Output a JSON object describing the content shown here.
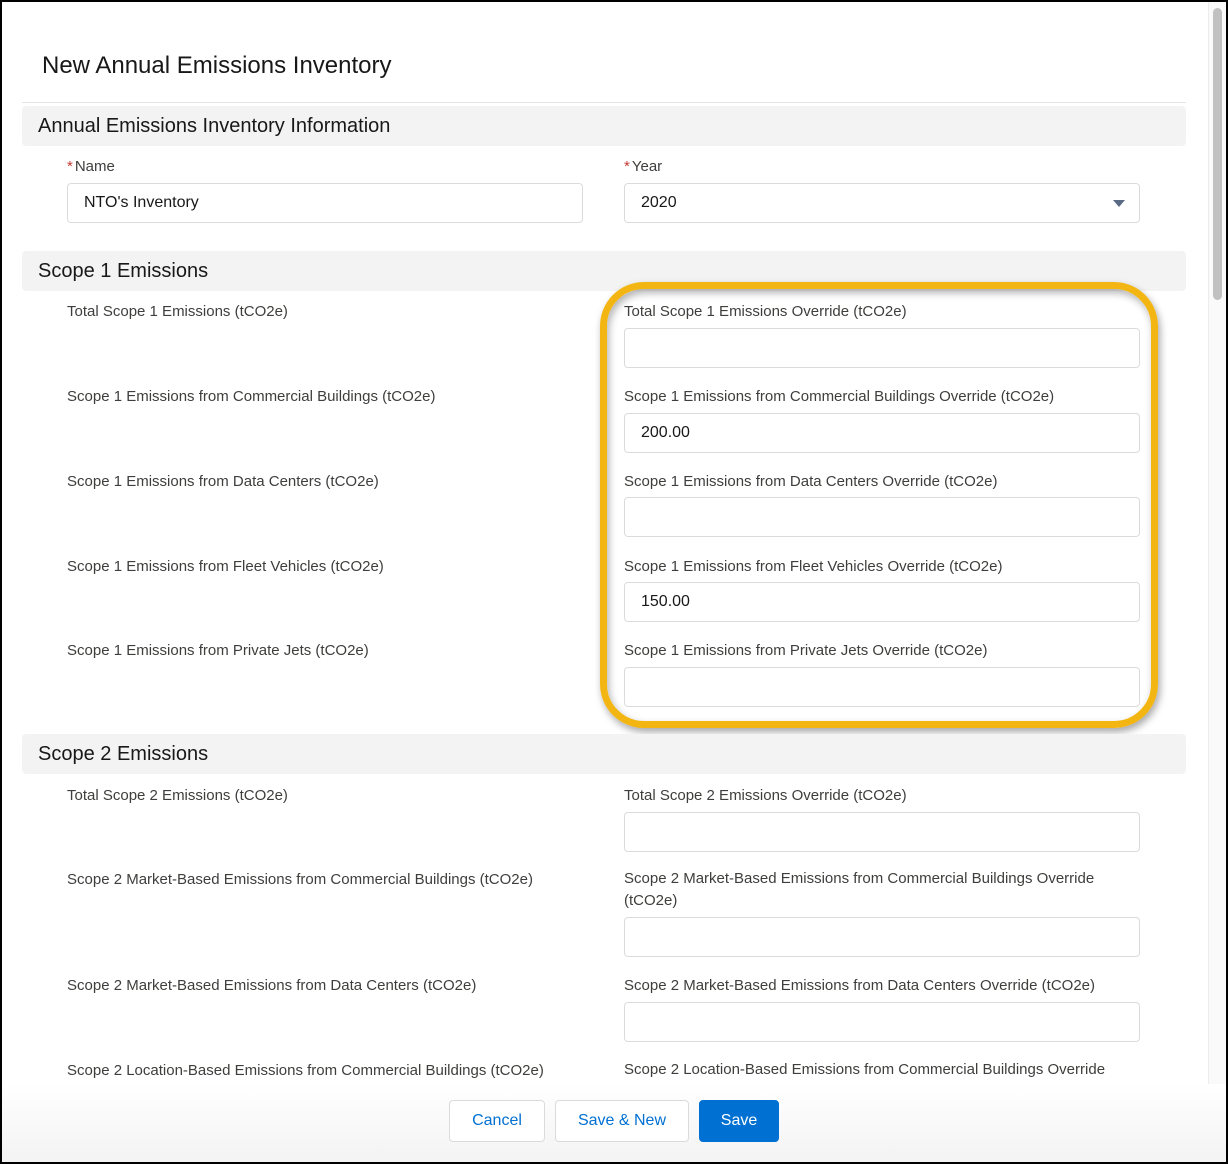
{
  "modal": {
    "title": "New Annual Emissions Inventory"
  },
  "sections": {
    "info": {
      "header": "Annual Emissions Inventory Information",
      "name_label": "Name",
      "name_value": "NTO's Inventory",
      "year_label": "Year",
      "year_value": "2020",
      "required_marker": "*"
    },
    "scope1": {
      "header": "Scope 1 Emissions",
      "fields": [
        {
          "label": "Total Scope 1 Emissions (tCO2e)",
          "override_label": "Total Scope 1 Emissions Override (tCO2e)",
          "override_value": ""
        },
        {
          "label": "Scope 1 Emissions from Commercial Buildings (tCO2e)",
          "override_label": "Scope 1 Emissions from Commercial Buildings Override (tCO2e)",
          "override_value": "200.00"
        },
        {
          "label": "Scope 1 Emissions from Data Centers (tCO2e)",
          "override_label": "Scope 1 Emissions from Data Centers Override (tCO2e)",
          "override_value": ""
        },
        {
          "label": "Scope 1 Emissions from Fleet Vehicles (tCO2e)",
          "override_label": "Scope 1 Emissions from Fleet Vehicles Override (tCO2e)",
          "override_value": "150.00"
        },
        {
          "label": "Scope 1 Emissions from Private Jets (tCO2e)",
          "override_label": "Scope 1 Emissions from Private Jets Override (tCO2e)",
          "override_value": ""
        }
      ]
    },
    "scope2": {
      "header": "Scope 2 Emissions",
      "fields": [
        {
          "label": "Total Scope 2 Emissions (tCO2e)",
          "override_label": "Total Scope 2 Emissions Override (tCO2e)",
          "override_value": ""
        },
        {
          "label": "Scope 2 Market-Based Emissions from Commercial Buildings (tCO2e)",
          "override_label": "Scope 2 Market-Based Emissions from Commercial Buildings Override (tCO2e)",
          "override_value": ""
        },
        {
          "label": "Scope 2 Market-Based Emissions from Data Centers (tCO2e)",
          "override_label": "Scope 2 Market-Based Emissions from Data Centers Override (tCO2e)",
          "override_value": ""
        },
        {
          "label": "Scope 2 Location-Based Emissions from Commercial Buildings (tCO2e)",
          "override_label": "Scope 2 Location-Based Emissions from Commercial Buildings Override",
          "override_value": ""
        }
      ]
    }
  },
  "footer": {
    "cancel_label": "Cancel",
    "save_new_label": "Save & New",
    "save_label": "Save"
  },
  "colors": {
    "brand": "#0070d2",
    "highlight": "#f3b512",
    "required": "#c23934"
  }
}
